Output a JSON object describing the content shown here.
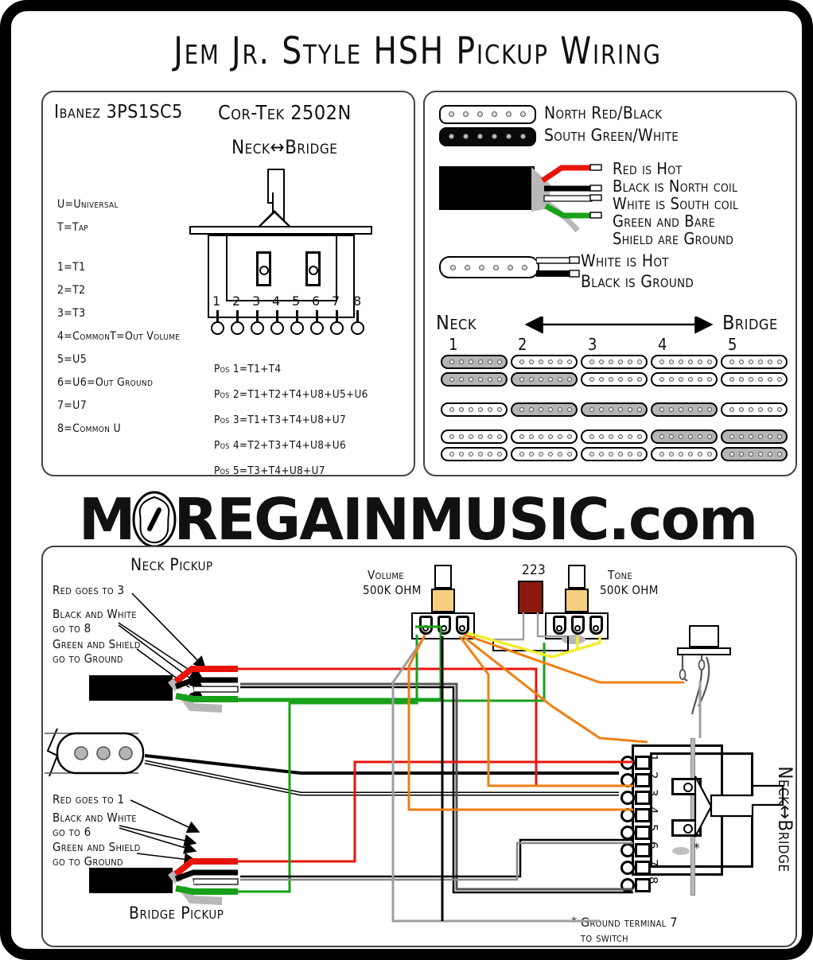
{
  "title": "Jem Jr. Style HSH Pickup Wiring",
  "switch_panel": {
    "brand_left": "Ibanez 3PS1SC5",
    "brand_right": "Cor-Tek 2502N",
    "orientation": "Neck↔Bridge",
    "legend": [
      "U=Universal",
      "T=Tap",
      "1=T1",
      "2=T2",
      "3=T3",
      "4=CommonT=Out Volume",
      "5=U5",
      "6=U6=Out Ground",
      "7=U7",
      "8=Common U"
    ],
    "terminal_numbers": [
      "1",
      "2",
      "3",
      "4",
      "5",
      "6",
      "7",
      "8"
    ],
    "positions": [
      "Pos 1=T1+T4",
      "Pos 2=T1+T2+T4+U8+U5+U6",
      "Pos 3=T1+T3+T4+U8+U7",
      "Pos 4=T2+T3+T4+U8+U6",
      "Pos 5=T3+T4+U8+U7"
    ]
  },
  "pickup_panel": {
    "coil_north_label": "North Red/Black",
    "coil_south_label": "South Green/White",
    "humbucker_wire_notes": [
      "Red is Hot",
      "Black is North coil",
      "White is South coil",
      "Green and Bare",
      "Shield are Ground"
    ],
    "single_coil_notes": [
      "White is Hot",
      "Black is Ground"
    ],
    "neck_label": "Neck",
    "bridge_label": "Bridge",
    "position_numbers": [
      "1",
      "2",
      "3",
      "4",
      "5"
    ],
    "matrix_caption": "",
    "matrix": [
      {
        "position": "1",
        "neck_hb_top": true,
        "neck_hb_bottom": true,
        "middle_sc": false,
        "bridge_hb_top": false,
        "bridge_hb_bottom": false
      },
      {
        "position": "2",
        "neck_hb_top": false,
        "neck_hb_bottom": true,
        "middle_sc": true,
        "bridge_hb_top": false,
        "bridge_hb_bottom": false
      },
      {
        "position": "3",
        "neck_hb_top": false,
        "neck_hb_bottom": false,
        "middle_sc": true,
        "bridge_hb_top": false,
        "bridge_hb_bottom": false
      },
      {
        "position": "4",
        "neck_hb_top": false,
        "neck_hb_bottom": false,
        "middle_sc": true,
        "bridge_hb_top": true,
        "bridge_hb_bottom": false
      },
      {
        "position": "5",
        "neck_hb_top": false,
        "neck_hb_bottom": false,
        "middle_sc": false,
        "bridge_hb_top": true,
        "bridge_hb_bottom": true
      }
    ]
  },
  "logo": {
    "pre": "M",
    "post": "REGAINMUSIC.com",
    "icon": "guitar-pickguard-icon"
  },
  "wiring_panel": {
    "neck_title": "Neck Pickup",
    "bridge_title": "Bridge Pickup",
    "neck_notes": [
      "Red goes to 3",
      "Black and White\ngo to 8",
      "Green and Shield\ngo to Ground"
    ],
    "bridge_notes": [
      "Red goes to 1",
      "Black and White\ngo to 6",
      "Green and Shield\ngo to Ground"
    ],
    "volume_label": "Volume",
    "volume_value": "500K OHM",
    "tone_label": "Tone",
    "tone_value": "500K OHM",
    "cap_label": "223",
    "switch_orientation": "Neck↔Bridge",
    "switch_numbers": [
      "1",
      "2",
      "3",
      "4",
      "5",
      "6",
      "7",
      "8"
    ],
    "footnote_marker": "*",
    "footnote": "Ground terminal 7\nto switch"
  },
  "colors": {
    "red": "#E8140C",
    "green": "#18A01A",
    "orange": "#F07F12",
    "yellow": "#F0EE28",
    "gray": "#9E9E9E",
    "black": "#000000",
    "white": "#FFFFFF",
    "pot_bush": "#F5CE80",
    "cap_body": "#8B1A0E",
    "matrix_active": "#B5B5B5"
  }
}
